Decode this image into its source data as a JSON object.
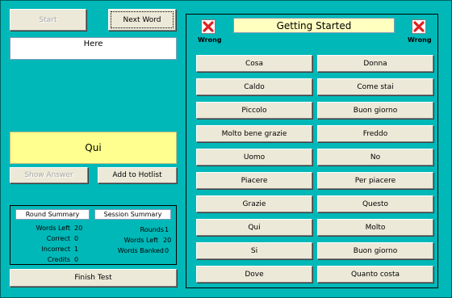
{
  "left": {
    "start_label": "Start",
    "next_word_label": "Next Word",
    "prompt_text": "Here",
    "answer_text": "Qui",
    "show_answer_label": "Show Answer",
    "add_to_hotlist_label": "Add to Hotlist",
    "finish_test_label": "Finish Test"
  },
  "summary": {
    "round_title": "Round Summary",
    "session_title": "Session Summary",
    "round": [
      {
        "label": "Words Left",
        "value": "20"
      },
      {
        "label": "Correct",
        "value": "0"
      },
      {
        "label": "Incorrect",
        "value": "1"
      },
      {
        "label": "Credits",
        "value": "0"
      }
    ],
    "session": [
      {
        "label": "Rounds",
        "value": "1"
      },
      {
        "label": "Words Left",
        "value": "20"
      },
      {
        "label": "Words Banked",
        "value": "0"
      }
    ]
  },
  "right": {
    "title": "Getting Started",
    "wrong_left_label": "Wrong",
    "wrong_right_label": "Wrong",
    "wrong_icon": "red-x-icon",
    "words_left": [
      "Cosa",
      "Caldo",
      "Piccolo",
      "Molto bene grazie",
      "Uomo",
      "Piacere",
      "Grazie",
      "Qui",
      "Si",
      "Dove"
    ],
    "words_right": [
      "Donna",
      "Come stai",
      "Buon giorno",
      "Freddo",
      "No",
      "Per piacere",
      "Questo",
      "Molto",
      "Buon giorno",
      "Quanto costa"
    ]
  },
  "colors": {
    "background": "#00b8b8",
    "answer_box": "#ffff90",
    "title_box": "#ffffc0",
    "wrong_icon_red": "#e02020"
  }
}
